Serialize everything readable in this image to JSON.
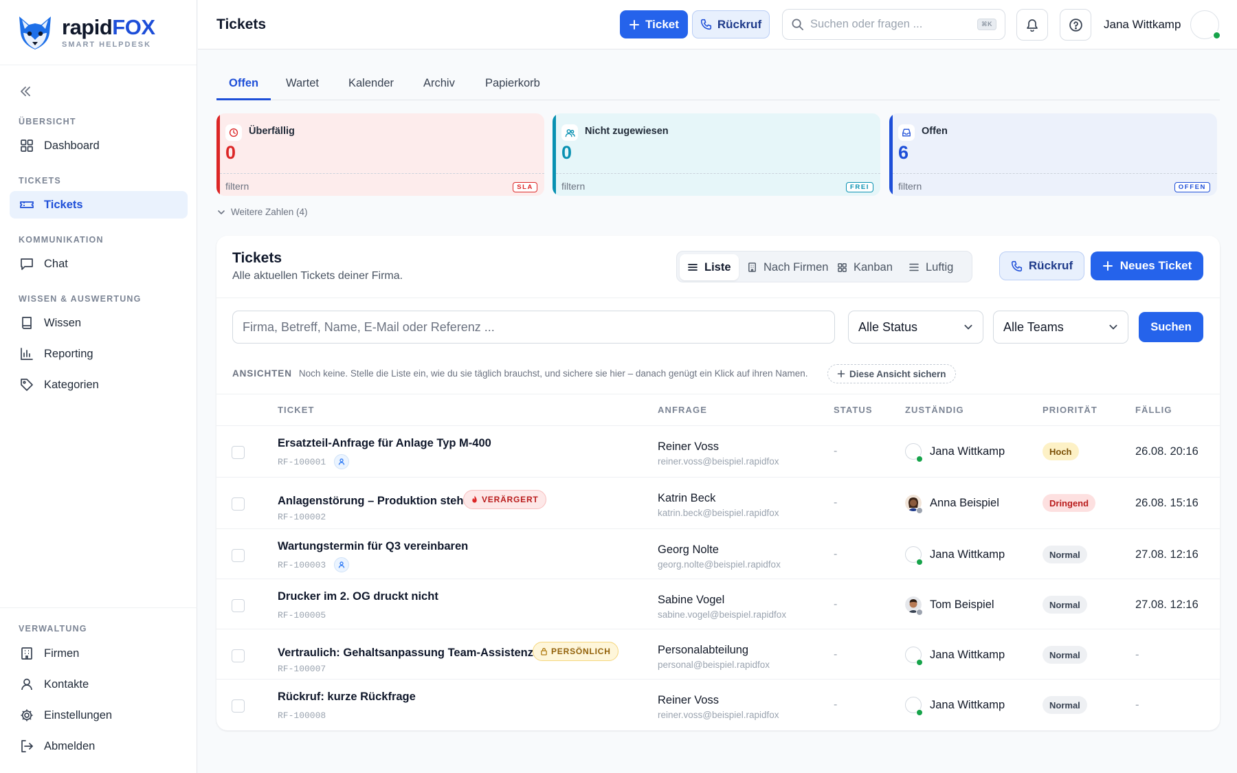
{
  "brand": {
    "name_part1": "rapid",
    "name_part2": "FOX",
    "tagline": "SMART HELPDESK"
  },
  "sidebar": {
    "sections": [
      {
        "title": "ÜBERSICHT"
      },
      {
        "title": "TICKETS"
      },
      {
        "title": "KOMMUNIKATION"
      },
      {
        "title": "WISSEN & AUSWERTUNG"
      },
      {
        "title": "VERWALTUNG"
      }
    ],
    "items": [
      {
        "label": "Dashboard",
        "icon": "grid-icon"
      },
      {
        "label": "Tickets",
        "icon": "ticket-icon",
        "active": true
      },
      {
        "label": "Chat",
        "icon": "chat-icon"
      },
      {
        "label": "Wissen",
        "icon": "book-icon"
      },
      {
        "label": "Reporting",
        "icon": "bar-chart-icon"
      },
      {
        "label": "Kategorien",
        "icon": "tag-icon"
      },
      {
        "label": "Firmen",
        "icon": "building-icon"
      },
      {
        "label": "Kontakte",
        "icon": "user-icon"
      },
      {
        "label": "Einstellungen",
        "icon": "gear-icon"
      },
      {
        "label": "Abmelden",
        "icon": "logout-icon"
      }
    ]
  },
  "topbar": {
    "title": "Tickets",
    "ticket_button": "Ticket",
    "callback_button": "Rückruf",
    "search_placeholder": "Suchen oder fragen ...",
    "search_shortcut": "⌘K",
    "user_name": "Jana Wittkamp"
  },
  "tabs": [
    {
      "label": "Offen",
      "active": true
    },
    {
      "label": "Wartet"
    },
    {
      "label": "Kalender"
    },
    {
      "label": "Archiv"
    },
    {
      "label": "Papierkorb"
    }
  ],
  "stats": [
    {
      "label": "Überfällig",
      "value": "0",
      "filter": "filtern",
      "tag": "SLA",
      "color": "#dc2626",
      "bg": "#fdecec"
    },
    {
      "label": "Nicht zugewiesen",
      "value": "0",
      "filter": "filtern",
      "tag": "FREI",
      "color": "#0891b2",
      "bg": "#e6f6f9"
    },
    {
      "label": "Offen",
      "value": "6",
      "filter": "filtern",
      "tag": "OFFEN",
      "color": "#1d4ed8",
      "bg": "#ecf1fb"
    }
  ],
  "more_numbers": "Weitere Zahlen (4)",
  "list": {
    "title": "Tickets",
    "subtitle": "Alle aktuellen Tickets deiner Firma.",
    "views": [
      {
        "label": "Liste",
        "active": true
      },
      {
        "label": "Nach Firmen"
      },
      {
        "label": "Kanban"
      },
      {
        "label": "Luftig"
      }
    ],
    "callback_button": "Rückruf",
    "new_ticket_button": "Neues Ticket",
    "filter_placeholder": "Firma, Betreff, Name, E-Mail oder Referenz ...",
    "status_select": "Alle Status",
    "teams_select": "Alle Teams",
    "search_button": "Suchen",
    "views_label": "ANSICHTEN",
    "views_hint": "Noch keine. Stelle die Liste ein, wie du sie täglich brauchst, und sichere sie hier – danach genügt ein Klick auf ihren Namen.",
    "save_view": "Diese Ansicht sichern",
    "columns": [
      "TICKET",
      "ANFRAGE",
      "STATUS",
      "ZUSTÄNDIG",
      "PRIORITÄT",
      "FÄLLIG"
    ],
    "rows": [
      {
        "title": "Ersatzteil-Anfrage für Anlage Typ M-400",
        "ref": "RF-100001",
        "badge": "",
        "person_icon": true,
        "requester": "Reiner Voss",
        "email": "reiner.voss@beispiel.rapidfox",
        "status": "-",
        "assignee": "Jana Wittkamp",
        "priority": "Hoch",
        "due": "26.08. 20:16"
      },
      {
        "title": "Anlagenstörung – Produktion steht",
        "ref": "RF-100002",
        "badge": "VERÄRGERT",
        "person_icon": false,
        "requester": "Katrin Beck",
        "email": "katrin.beck@beispiel.rapidfox",
        "status": "-",
        "assignee": "Anna Beispiel",
        "priority": "Dringend",
        "due": "26.08. 15:16"
      },
      {
        "title": "Wartungstermin für Q3 vereinbaren",
        "ref": "RF-100003",
        "badge": "",
        "person_icon": true,
        "requester": "Georg Nolte",
        "email": "georg.nolte@beispiel.rapidfox",
        "status": "-",
        "assignee": "Jana Wittkamp",
        "priority": "Normal",
        "due": "27.08. 12:16"
      },
      {
        "title": "Drucker im 2. OG druckt nicht",
        "ref": "RF-100005",
        "badge": "",
        "person_icon": false,
        "requester": "Sabine Vogel",
        "email": "sabine.vogel@beispiel.rapidfox",
        "status": "-",
        "assignee": "Tom Beispiel",
        "priority": "Normal",
        "due": "27.08. 12:16"
      },
      {
        "title": "Vertraulich: Gehaltsanpassung Team-Assistenz",
        "ref": "RF-100007",
        "badge": "PERSÖNLICH",
        "person_icon": false,
        "requester": "Personalabteilung",
        "email": "personal@beispiel.rapidfox",
        "status": "-",
        "assignee": "Jana Wittkamp",
        "priority": "Normal",
        "due": "-"
      },
      {
        "title": "Rückruf: kurze Rückfrage",
        "ref": "RF-100008",
        "badge": "",
        "person_icon": false,
        "requester": "Reiner Voss",
        "email": "reiner.voss@beispiel.rapidfox",
        "status": "-",
        "assignee": "Jana Wittkamp",
        "priority": "Normal",
        "due": "-"
      }
    ]
  }
}
